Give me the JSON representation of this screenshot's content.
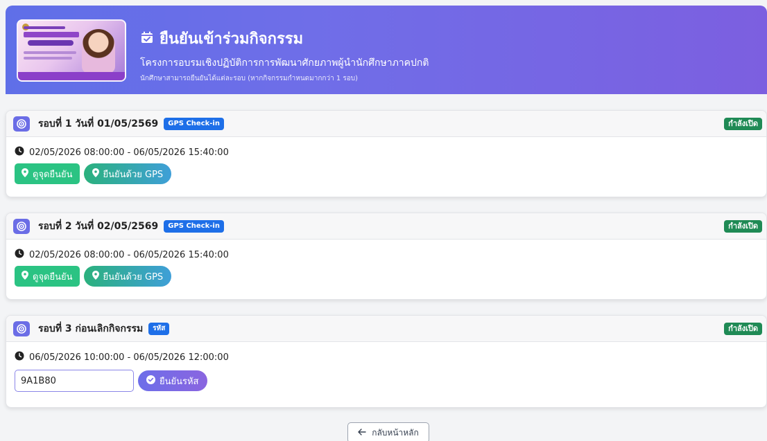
{
  "header": {
    "title": "ยืนยันเข้าร่วมกิจกรรม",
    "subtitle": "โครงการอบรมเชิงปฏิบัติการการพัฒนาศักยภาพผู้นำนักศึกษาภาคปกติ",
    "note": "นักศึกษาสามารถยืนยันได้แต่ละรอบ (หากกิจกรรมกำหนดมากกว่า 1 รอบ)"
  },
  "rounds": [
    {
      "title": "รอบที่ 1 วันที่ 01/05/2569",
      "method": "GPS Check-in",
      "status": "กำลังเปิด",
      "time": "02/05/2026 08:00:00 - 06/05/2026 15:40:00",
      "view_label": "ดูจุดยืนยัน",
      "gps_label": "ยืนยันด้วย GPS"
    },
    {
      "title": "รอบที่ 2 วันที่ 02/05/2569",
      "method": "GPS Check-in",
      "status": "กำลังเปิด",
      "time": "02/05/2026 08:00:00 - 06/05/2026 15:40:00",
      "view_label": "ดูจุดยืนยัน",
      "gps_label": "ยืนยันด้วย GPS"
    },
    {
      "title": "รอบที่ 3 ก่อนเลิกกิจกรรม",
      "method": "รหัส",
      "status": "กำลังเปิด",
      "time": "06/05/2026 10:00:00 - 06/05/2026 12:00:00",
      "code_value": "9A1B80",
      "confirm_label": "ยืนยันรหัส"
    }
  ],
  "footer": {
    "back_label": "กลับหน้าหลัก"
  },
  "colors": {
    "accent": "#6b6de6",
    "status": "#1f8a55",
    "chip": "#1e6fe8",
    "green": "#2bc383"
  }
}
